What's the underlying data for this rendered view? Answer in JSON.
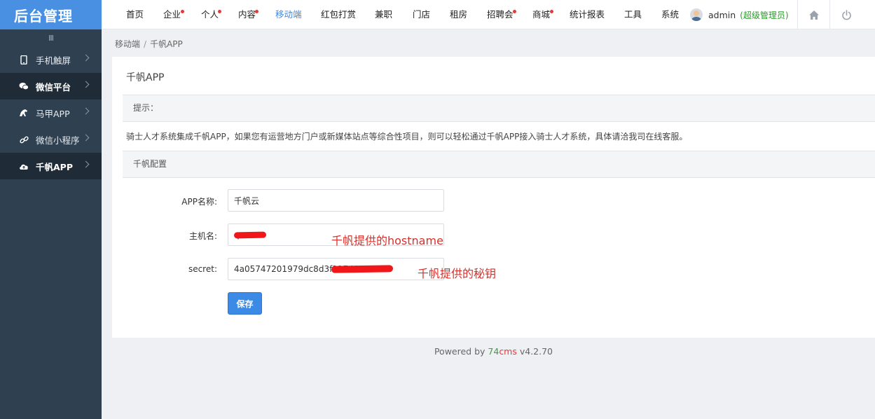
{
  "sidebar": {
    "logo": "后台管理",
    "collapse_glyph": "III",
    "items": [
      {
        "label": "手机触屏",
        "icon": "mobile-icon"
      },
      {
        "label": "微信平台",
        "icon": "wechat-icon"
      },
      {
        "label": "马甲APP",
        "icon": "horse-icon"
      },
      {
        "label": "微信小程序",
        "icon": "link-icon"
      },
      {
        "label": "千帆APP",
        "icon": "cloud-icon"
      }
    ]
  },
  "topnav": {
    "items": [
      {
        "label": "首页"
      },
      {
        "label": "企业",
        "badge": true
      },
      {
        "label": "个人",
        "badge": true
      },
      {
        "label": "内容",
        "badge": true
      },
      {
        "label": "移动端",
        "active": true
      },
      {
        "label": "红包打赏"
      },
      {
        "label": "兼职"
      },
      {
        "label": "门店"
      },
      {
        "label": "租房"
      },
      {
        "label": "招聘会",
        "badge": true
      },
      {
        "label": "商城",
        "badge": true
      },
      {
        "label": "统计报表"
      },
      {
        "label": "工具"
      },
      {
        "label": "系统"
      }
    ],
    "user": {
      "name": "admin",
      "role": "(超级管理员)"
    },
    "home_icon": "home-icon",
    "power_icon": "power-icon"
  },
  "breadcrumb": {
    "parent": "移动端",
    "separator": "/",
    "current": "千帆APP"
  },
  "panel": {
    "title": "千帆APP",
    "tip_heading": "提示：",
    "tip_text": "骑士人才系统集成千帆APP，如果您有运营地方门户或新媒体站点等综合性项目，则可以轻松通过千帆APP接入骑士人才系统，具体请洽我司在线客服。",
    "config_heading": "千帆配置",
    "fields": {
      "app_name": {
        "label": "APP名称:",
        "value": "千帆云"
      },
      "hostname": {
        "label": "主机名:",
        "value": "q",
        "annotation": "千帆提供的hostname"
      },
      "secret": {
        "label": "secret:",
        "value": "4a05747201979dc8d3f117497",
        "annotation": "千帆提供的秘钥"
      }
    },
    "save_label": "保存"
  },
  "footer": {
    "prefix": "Powered by ",
    "brand_74": "74",
    "brand_cms": "cms",
    "version": " v4.2.70"
  },
  "colors": {
    "accent": "#3b8ae6",
    "sidebar": "#2f4050",
    "logo_bg": "#4a90e2",
    "badge": "#e4393c",
    "annotation": "#d8302a",
    "role": "#2f9a2f"
  }
}
